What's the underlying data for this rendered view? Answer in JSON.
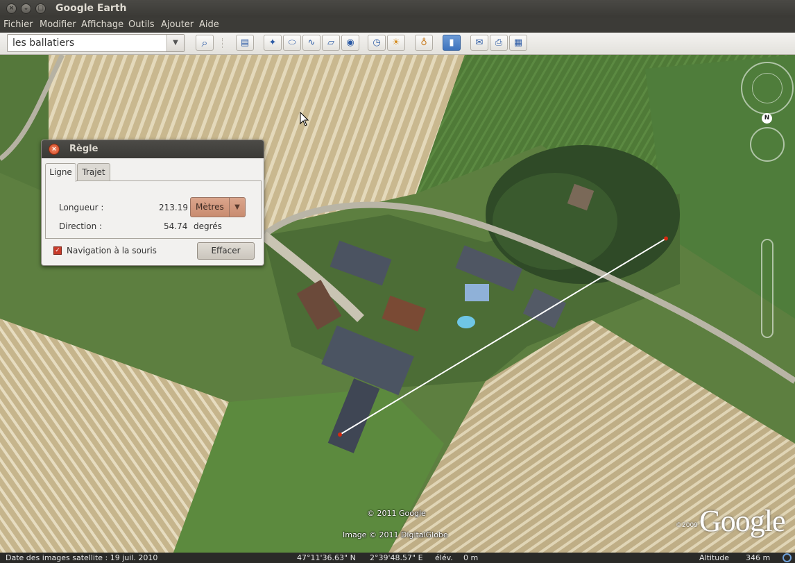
{
  "window": {
    "title": "Google Earth",
    "controls": {
      "close": "×",
      "minimize": "⌄",
      "maximize": "□"
    }
  },
  "menu": [
    "Fichier",
    "Modifier",
    "Affichage",
    "Outils",
    "Ajouter",
    "Aide"
  ],
  "search": {
    "value": "les ballatiers",
    "dropdown_icon": "▼"
  },
  "toolbar": {
    "search_icon": "⌕",
    "buttons": [
      "sidebar-icon",
      "placemark-icon",
      "polygon-icon",
      "path-icon",
      "overlay-icon",
      "tour-icon",
      "clock-icon",
      "sunlight-icon",
      "planet-icon",
      "ruler-icon",
      "email-icon",
      "print-icon",
      "maps-icon"
    ],
    "glyphs": [
      "▤",
      "✦",
      "⬭",
      "∿",
      "▱",
      "◉",
      "◷",
      "☀",
      "♁",
      "▮",
      "✉",
      "⎙",
      "▦"
    ],
    "active": "ruler-icon"
  },
  "map": {
    "credit_google": "© 2011 Google",
    "credit_image": "Image © 2011 DigitalGlobe",
    "logo_year": "©2009",
    "logo_text": "Google",
    "compass_north": "N",
    "measure_line": {
      "length": "213.19",
      "direction": "54.74"
    }
  },
  "ruler": {
    "title": "Règle",
    "close": "×",
    "tabs": [
      "Ligne",
      "Trajet"
    ],
    "active_tab": "Ligne",
    "length_label": "Longueur :",
    "length_value": "213.19",
    "units": "Mètres",
    "units_arrow": "▼",
    "direction_label": "Direction :",
    "direction_value": "54.74",
    "direction_unit": "degrés",
    "mouse_nav_label": "Navigation à la souris",
    "mouse_nav_checked": true,
    "check_mark": "✓",
    "clear_button": "Effacer"
  },
  "status": {
    "imagery_date": "Date des images satellite : 19 juil. 2010",
    "latitude": "47°11'36.63\" N",
    "longitude": "2°39'48.57\" E",
    "elevation_label": "élév.",
    "elevation": "0 m",
    "altitude_label": "Altitude",
    "altitude": "346 m"
  },
  "colors": {
    "accent": "#3e73bd",
    "measure_line": "#ffffff",
    "measure_endpoint": "#d42a10"
  }
}
